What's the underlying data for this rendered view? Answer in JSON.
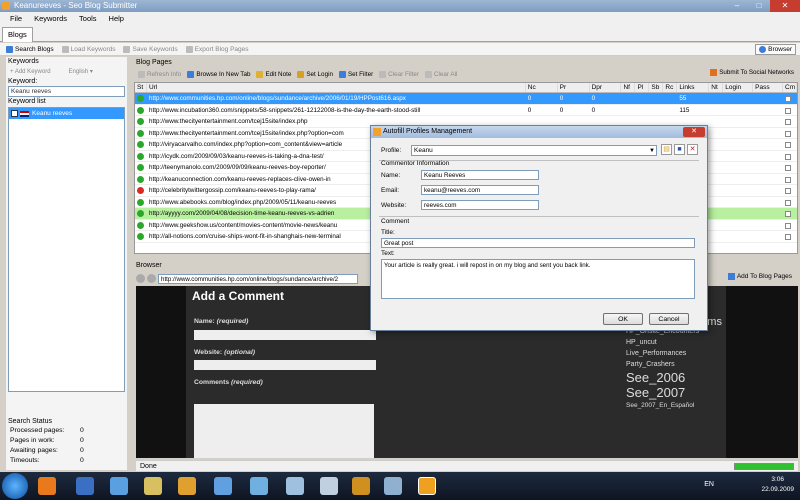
{
  "window": {
    "title": "Keanureeves - Seo Blog Submitter",
    "minimize": "–",
    "maximize": "□",
    "close": "✕"
  },
  "menu": [
    "File",
    "Keywords",
    "Tools",
    "Help"
  ],
  "tabs": [
    "Blogs"
  ],
  "toolbar": {
    "search_blogs": "Search Blogs",
    "load_keywords": "Load Keywords",
    "save_keywords": "Save Keywords",
    "export_blog_pages": "Export Blog Pages",
    "browser": "Browser"
  },
  "left": {
    "keywords_title": "Keywords",
    "add_keyword": "Add Keyword",
    "language": "English",
    "keyword_label": "Keyword:",
    "keyword_value": "Keanu reeves",
    "keyword_list_title": "Keyword list",
    "keyword_items": [
      "Keanu reeves"
    ],
    "search_status": {
      "title": "Search Status",
      "rows": [
        {
          "label": "Processed pages:",
          "value": "0"
        },
        {
          "label": "Pages in work:",
          "value": "0"
        },
        {
          "label": "Awaiting pages:",
          "value": "0"
        },
        {
          "label": "Timeouts:",
          "value": "0"
        }
      ]
    }
  },
  "blog_pages": {
    "title": "Blog Pages",
    "toolbar": {
      "refresh": "Refresh Info",
      "browse_new_tab": "Browse In New Tab",
      "edit_note": "Edit Note",
      "set_login": "Set Login",
      "set_filter": "Set Filter",
      "clear_filter": "Clear Filter",
      "clear_all": "Clear All",
      "submit_social": "Submit To Social Networks"
    },
    "columns": [
      "St",
      "Url",
      "Nc",
      "Pr",
      "Dpr",
      "Nf",
      "Pl",
      "Sb",
      "Rc",
      "Links",
      "Nt",
      "Login",
      "Pass",
      "Cm"
    ],
    "rows": [
      {
        "status": "green",
        "url": "http://www.communities.hp.com/online/blogs/sundance/archive/2006/01/19/HPPost616.aspx",
        "nc": "0",
        "pr": "0",
        "dpr": "0",
        "links": "55",
        "style": "sel"
      },
      {
        "status": "green",
        "url": "http://www.incubation360.com/snippets/58-snippets/261-12122008-is-the-day-the-earth-stood-still",
        "nc": "0",
        "pr": "0",
        "dpr": "0",
        "links": "115",
        "style": ""
      },
      {
        "status": "green",
        "url": "http://www.thecityentertainment.com/tcej15site/index.php",
        "nc": "",
        "pr": "",
        "dpr": "",
        "links": "",
        "style": ""
      },
      {
        "status": "green",
        "url": "http://www.thecityentertainment.com/tcej15site/index.php?option=com",
        "nc": "",
        "pr": "",
        "dpr": "",
        "links": "",
        "style": ""
      },
      {
        "status": "green",
        "url": "http://viryacarvalho.com/index.php?option=com_content&view=article",
        "nc": "",
        "pr": "",
        "dpr": "",
        "links": "",
        "style": ""
      },
      {
        "status": "green",
        "url": "http://icydk.com/2009/09/03/keanu-reeves-is-taking-a-dna-test/",
        "nc": "",
        "pr": "",
        "dpr": "",
        "links": "",
        "style": ""
      },
      {
        "status": "green",
        "url": "http://teenymanolo.com/2009/09/09/keanu-reeves-boy-reporter/",
        "nc": "",
        "pr": "",
        "dpr": "",
        "links": "",
        "style": ""
      },
      {
        "status": "green",
        "url": "http://keanuconnection.com/keanu-reeves-replaces-clive-owen-in",
        "nc": "",
        "pr": "",
        "dpr": "",
        "links": "",
        "style": ""
      },
      {
        "status": "red",
        "url": "http://celebritytwittergossip.com/keanu-reeves-to-play-rama/",
        "nc": "",
        "pr": "",
        "dpr": "",
        "links": "",
        "style": ""
      },
      {
        "status": "green",
        "url": "http://www.abebooks.com/blog/index.php/2009/05/11/keanu-reeves",
        "nc": "",
        "pr": "",
        "dpr": "",
        "links": "",
        "style": ""
      },
      {
        "status": "green",
        "url": "http://ayyyy.com/2009/04/08/decision-time-keanu-reeves-vs-adrien",
        "nc": "",
        "pr": "",
        "dpr": "",
        "links": "",
        "style": "green"
      },
      {
        "status": "green",
        "url": "http://www.geekshow.us/content/movies-content/movie-news/keanu",
        "nc": "",
        "pr": "",
        "dpr": "",
        "links": "",
        "style": ""
      },
      {
        "status": "green",
        "url": "http://all-notions.com/cruise-ships-wont-fit-in-shanghais-new-terminal",
        "nc": "",
        "pr": "",
        "dpr": "",
        "links": "",
        "style": ""
      }
    ]
  },
  "browser": {
    "title": "Browser",
    "address": "http://www.communities.hp.com/online/blogs/sundance/archive/2",
    "add_to_blog_pages": "Add To Blog Pages",
    "page": {
      "heading": "Add a Comment",
      "name_label": "Name:",
      "name_req": "(required)",
      "website_label": "Website:",
      "website_opt": "(optional)",
      "comments_label": "Comments",
      "comments_req": "(required)",
      "tags": [
        "es Celebrities Films",
        "HP_Onsite_Encounters",
        "HP_uncut",
        "Live_Performances",
        "Party_Crashers",
        "See_2006",
        "See_2007",
        "See_2007_En_Español"
      ]
    },
    "status": "Done"
  },
  "dialog": {
    "title": "Autofill Profiles Management",
    "profile_label": "Profile:",
    "profile_value": "Keanu",
    "commentor_title": "Commentor Information",
    "name_label": "Name:",
    "name_value": "Keanu Reeves",
    "email_label": "Email:",
    "email_value": "keanu@reeves.com",
    "website_label": "Website:",
    "website_value": "reeves.com",
    "comment_title": "Comment",
    "comment_title_label": "Title:",
    "comment_title_value": "Great post",
    "text_label": "Text:",
    "text_value": "Your article is really great. i will repost in on my blog and sent you back link.",
    "ok": "OK",
    "cancel": "Cancel"
  },
  "taskbar": {
    "lang": "EN",
    "time": "3:06",
    "date": "22.09.2009"
  }
}
